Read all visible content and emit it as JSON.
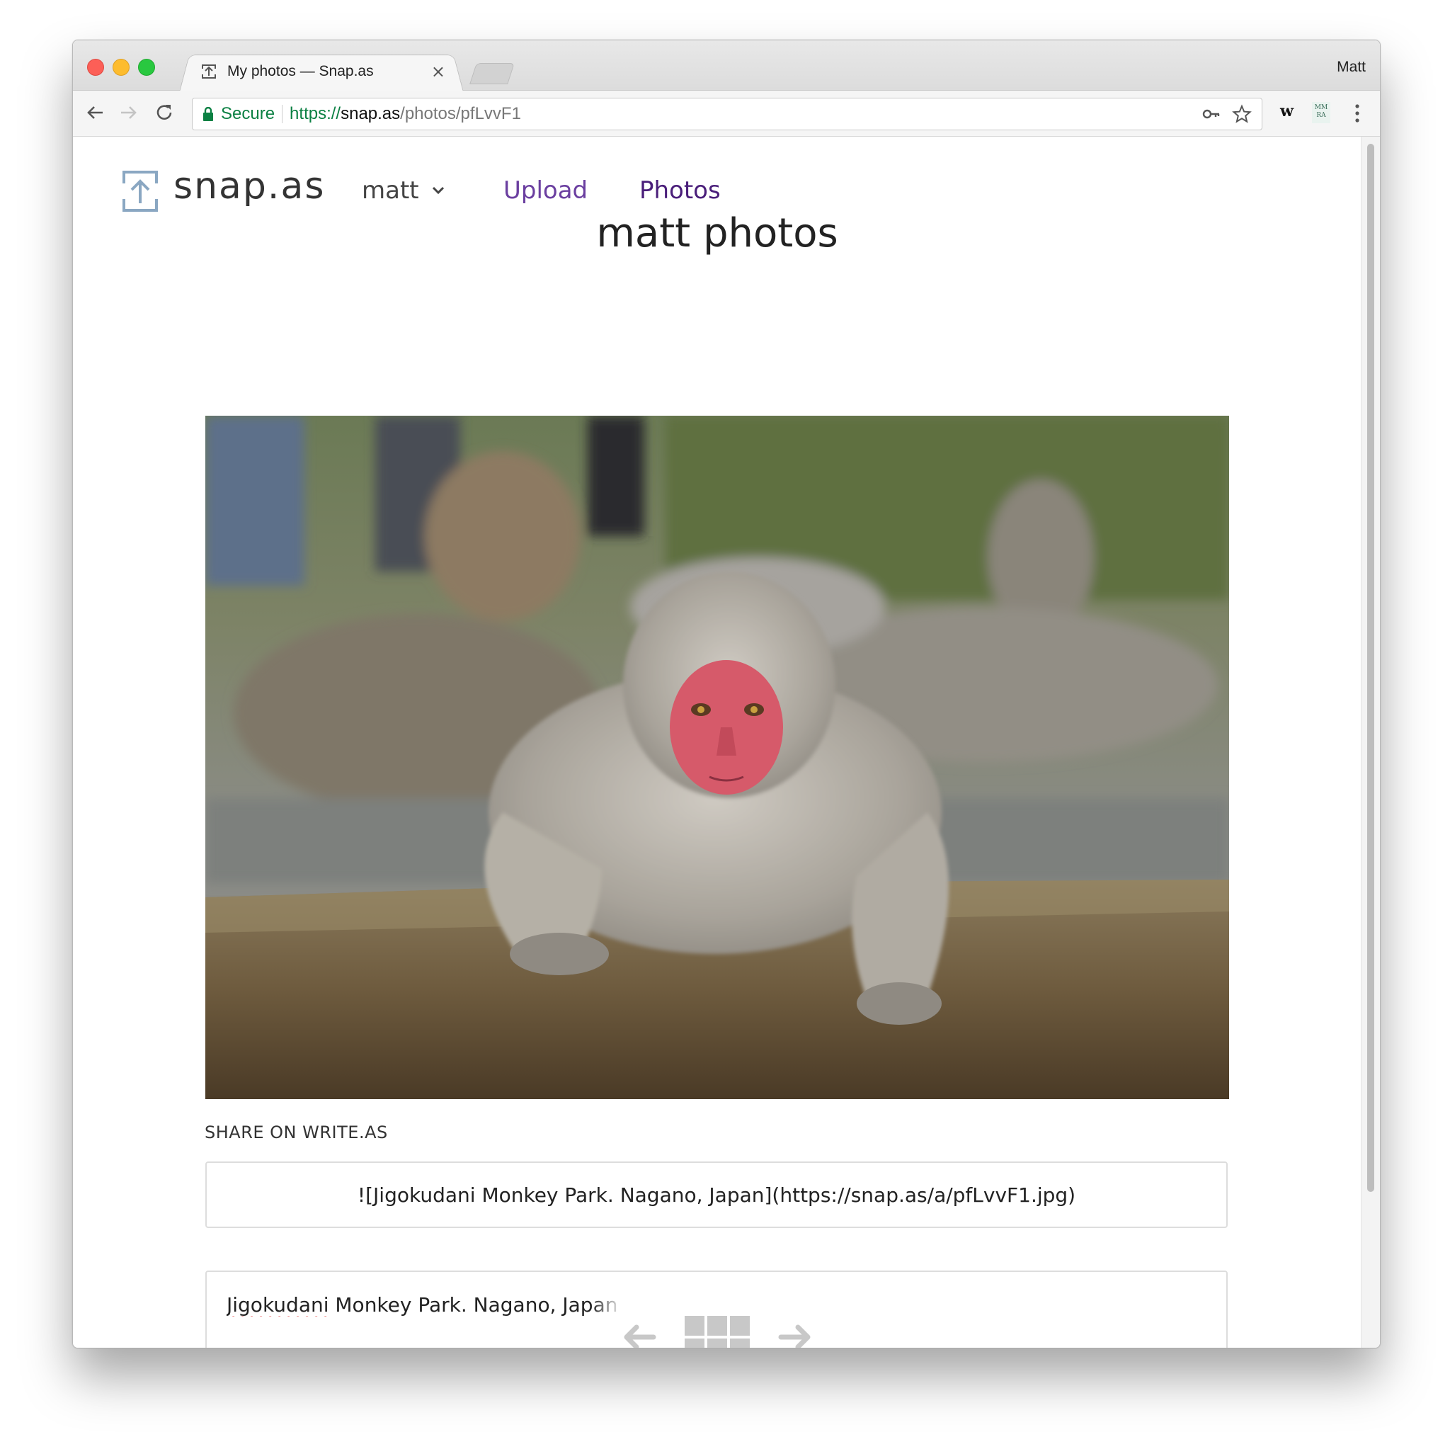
{
  "browser": {
    "tab_title": "My photos — Snap.as",
    "tab_close": "×",
    "profile_name": "Matt",
    "secure_label": "Secure",
    "url_scheme": "https://",
    "url_host": "snap.as",
    "url_path": "/photos/pfLvvF1",
    "extension_w": "w",
    "extension_mm_line1": "MM",
    "extension_mm_line2": "RA"
  },
  "site": {
    "logo_text": "snap.as",
    "user_menu_label": "matt",
    "nav_upload": "Upload",
    "nav_photos": "Photos",
    "page_title": "matt photos"
  },
  "photo": {
    "subject": "Snow monkey resting on a rock by a hot spring"
  },
  "share": {
    "label": "SHARE ON WRITE.AS",
    "markdown": "![Jigokudani Monkey Park. Nagano, Japan](https://snap.as/a/pfLvvF1.jpg)"
  },
  "caption": {
    "first_word": "Jigokudani",
    "rest": " Monkey Park. Nagano, Japan"
  },
  "colors": {
    "accent": "#6b3fa0",
    "nav_active": "#4a1e7a",
    "secure_green": "#0b8043",
    "pager_icon": "#c8c8c8"
  }
}
